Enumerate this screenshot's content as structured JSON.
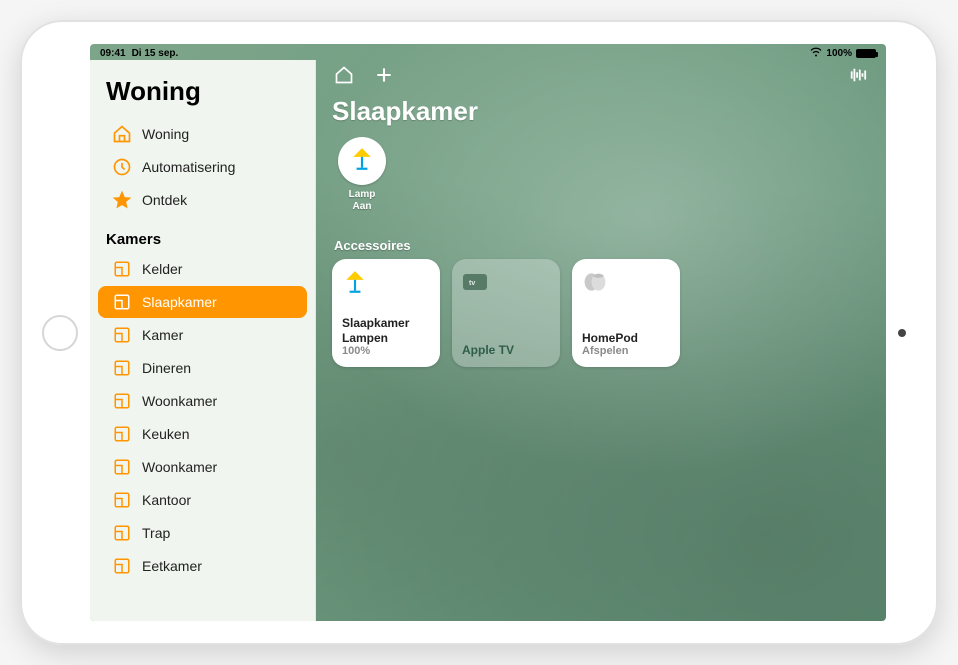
{
  "statusbar": {
    "time": "09:41",
    "date": "Di 15 sep.",
    "battery_pct": "100%"
  },
  "sidebar": {
    "title": "Woning",
    "nav": [
      {
        "label": "Woning",
        "icon": "house"
      },
      {
        "label": "Automatisering",
        "icon": "clock"
      },
      {
        "label": "Ontdek",
        "icon": "star"
      }
    ],
    "rooms_header": "Kamers",
    "rooms": [
      {
        "label": "Kelder",
        "active": false
      },
      {
        "label": "Slaapkamer",
        "active": true
      },
      {
        "label": "Kamer",
        "active": false
      },
      {
        "label": "Dineren",
        "active": false
      },
      {
        "label": "Woonkamer",
        "active": false
      },
      {
        "label": "Keuken",
        "active": false
      },
      {
        "label": "Woonkamer",
        "active": false
      },
      {
        "label": "Kantoor",
        "active": false
      },
      {
        "label": "Trap",
        "active": false
      },
      {
        "label": "Eetkamer",
        "active": false
      }
    ]
  },
  "main": {
    "room_title": "Slaapkamer",
    "favorite": {
      "name": "Lamp",
      "state": "Aan"
    },
    "accessories_header": "Accessoires",
    "tiles": [
      {
        "title": "Slaapkamer Lampen",
        "subtitle": "100%",
        "state": "on",
        "icon": "lamp"
      },
      {
        "title": "Apple TV",
        "subtitle": "",
        "state": "off",
        "icon": "appletv"
      },
      {
        "title": "HomePod",
        "subtitle": "Afspelen",
        "state": "on",
        "icon": "homepod"
      }
    ]
  }
}
